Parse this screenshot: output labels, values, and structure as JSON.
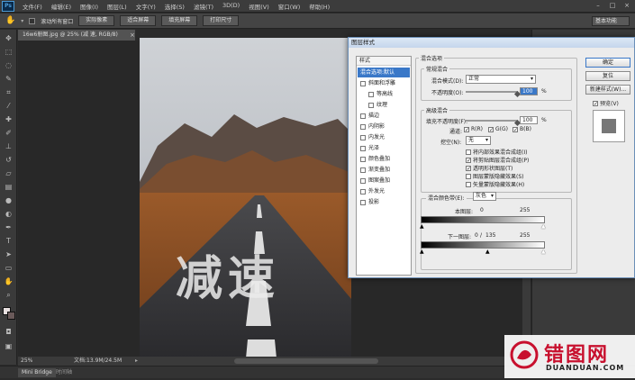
{
  "app": {
    "logo": "Ps"
  },
  "menubar": [
    "文件(F)",
    "编辑(E)",
    "图像(I)",
    "图层(L)",
    "文字(Y)",
    "选择(S)",
    "滤镜(T)",
    "3D(D)",
    "视图(V)",
    "窗口(W)",
    "帮助(H)"
  ],
  "window_controls": [
    "–",
    "□",
    "×"
  ],
  "optionsbar": {
    "scroll_all_windows": "滚动所有窗口",
    "actual_pixels": "实际像素",
    "fit_screen": "适合屏幕",
    "fill_screen": "填充屏幕",
    "print_size": "打印尺寸",
    "workspace": "基本功能"
  },
  "document": {
    "tab_title": "16w6册图.jpg @ 25% (减 速, RGB/8)",
    "zoom": "25%",
    "doc_info": "文档:13.9M/24.5M",
    "overlay_text": "减速"
  },
  "bottom": {
    "mini_bridge": "Mini Bridge",
    "timeline": "时间轴"
  },
  "dialog": {
    "title": "图层样式",
    "styles_header": "样式",
    "styles": [
      {
        "label": "混合选项:默认",
        "selected": true,
        "checkbox": false,
        "sub": false
      },
      {
        "label": "斜面和浮雕",
        "selected": false,
        "checkbox": true,
        "sub": false
      },
      {
        "label": "等高线",
        "selected": false,
        "checkbox": true,
        "sub": true
      },
      {
        "label": "纹理",
        "selected": false,
        "checkbox": true,
        "sub": true
      },
      {
        "label": "描边",
        "selected": false,
        "checkbox": true,
        "sub": false
      },
      {
        "label": "内阴影",
        "selected": false,
        "checkbox": true,
        "sub": false
      },
      {
        "label": "内发光",
        "selected": false,
        "checkbox": true,
        "sub": false
      },
      {
        "label": "光泽",
        "selected": false,
        "checkbox": true,
        "sub": false
      },
      {
        "label": "颜色叠加",
        "selected": false,
        "checkbox": true,
        "sub": false
      },
      {
        "label": "渐变叠加",
        "selected": false,
        "checkbox": true,
        "sub": false
      },
      {
        "label": "图案叠加",
        "selected": false,
        "checkbox": true,
        "sub": false
      },
      {
        "label": "外发光",
        "selected": false,
        "checkbox": true,
        "sub": false
      },
      {
        "label": "投影",
        "selected": false,
        "checkbox": true,
        "sub": false
      }
    ],
    "blend_options_title": "混合选项",
    "general_blending": {
      "title": "常规混合",
      "mode_label": "混合模式(D):",
      "mode_value": "正常",
      "opacity_label": "不透明度(O):",
      "opacity_value": "100",
      "opacity_fraction": 1.0,
      "unit": "%"
    },
    "advanced_blending": {
      "title": "高级混合",
      "fill_label": "填充不透明度(F):",
      "fill_value": "100",
      "fill_fraction": 1.0,
      "unit": "%",
      "channels_label": "通道:",
      "channels": [
        "R(R)",
        "G(G)",
        "B(B)"
      ],
      "knockout_label": "挖空(N):",
      "knockout_value": "无",
      "options": [
        {
          "label": "将内部效果混合成组(I)",
          "checked": false
        },
        {
          "label": "将剪贴图层混合成组(P)",
          "checked": true
        },
        {
          "label": "透明形状图层(T)",
          "checked": true
        },
        {
          "label": "图层蒙版隐藏效果(S)",
          "checked": false
        },
        {
          "label": "矢量蒙版隐藏效果(H)",
          "checked": false
        }
      ]
    },
    "blend_if": {
      "label": "混合颜色带(E):",
      "value": "灰色",
      "this_layer_label": "本图层:",
      "this_layer_low": "0",
      "this_layer_high": "255",
      "underlying_label": "下一图层:",
      "underlying_low": "0",
      "underlying_mid": "135",
      "underlying_sep": "/",
      "underlying_high": "255"
    },
    "buttons": {
      "ok": "确定",
      "reset": "复位",
      "new_style": "新建样式(W)...",
      "preview": "预览(V)"
    },
    "preview_checked": true
  },
  "watermark": {
    "brand": "错图网",
    "domain": "DUANDUAN.COM"
  },
  "colors": {
    "accent": "#3a78c8",
    "watermark_red": "#c8102e"
  }
}
